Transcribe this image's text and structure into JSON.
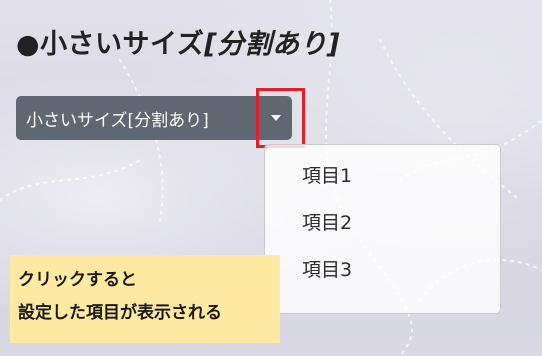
{
  "heading": {
    "bullet": "●",
    "main": "小さいサイズ",
    "suffix": "[分割あり]"
  },
  "split_button": {
    "label": "小さいサイズ[分割あり]",
    "toggle_icon": "caret-down-icon"
  },
  "dropdown": {
    "items": [
      "項目1",
      "項目2",
      "項目3"
    ]
  },
  "note": {
    "line1": "クリックすると",
    "line2": "設定した項目が表示される"
  },
  "colors": {
    "button": "#5f6872",
    "highlight": "#e3202a",
    "note_bg": "#ffe9a3"
  }
}
